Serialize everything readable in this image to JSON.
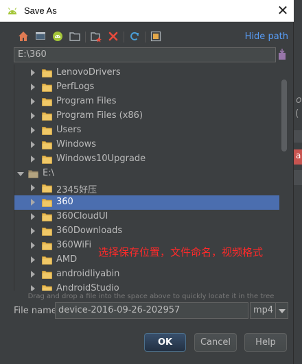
{
  "window": {
    "title": "Save As",
    "close_glyph": "✕"
  },
  "toolbar": {
    "icons": [
      "home-icon",
      "desktop-icon",
      "android-project-icon",
      "folder-icon",
      "new-folder-icon",
      "delete-icon",
      "refresh-icon",
      "show-hidden-icon"
    ],
    "hide_path_label": "Hide path"
  },
  "path": {
    "value": "E:\\360"
  },
  "tree": {
    "rows": [
      {
        "label": "LenovoDrivers",
        "expanded": false,
        "selected": false
      },
      {
        "label": "PerfLogs",
        "expanded": false,
        "selected": false
      },
      {
        "label": "Program Files",
        "expanded": false,
        "selected": false
      },
      {
        "label": "Program Files (x86)",
        "expanded": false,
        "selected": false
      },
      {
        "label": "Users",
        "expanded": false,
        "selected": false
      },
      {
        "label": "Windows",
        "expanded": false,
        "selected": false
      },
      {
        "label": "Windows10Upgrade",
        "expanded": false,
        "selected": false
      },
      {
        "label": "E:\\",
        "expanded": true,
        "selected": false,
        "drive": true
      },
      {
        "label": "2345好压",
        "expanded": false,
        "selected": false
      },
      {
        "label": "360",
        "expanded": false,
        "selected": true
      },
      {
        "label": "360CloudUI",
        "expanded": false,
        "selected": false
      },
      {
        "label": "360Downloads",
        "expanded": false,
        "selected": false
      },
      {
        "label": "360WiFi",
        "expanded": false,
        "selected": false
      },
      {
        "label": "AMD",
        "expanded": false,
        "selected": false
      },
      {
        "label": "androidliyabin",
        "expanded": false,
        "selected": false
      },
      {
        "label": "AndroidStudio",
        "expanded": false,
        "selected": false
      }
    ]
  },
  "annotation": "选择保存位置，文件命名，视频格式",
  "hint": "Drag and drop a file into the space above to quickly locate it in the tree",
  "filename": {
    "label": "File name:",
    "value": "device-2016-09-26-202957",
    "extension": "mp4"
  },
  "buttons": {
    "ok": "OK",
    "cancel": "Cancel",
    "help": "Help"
  },
  "background": {
    "chars": [
      "o",
      "(",
      "a"
    ]
  },
  "colors": {
    "selection": "#4b6eaf",
    "link": "#589df6",
    "annotation": "#ff2a2a",
    "folder": "#e8b952"
  }
}
